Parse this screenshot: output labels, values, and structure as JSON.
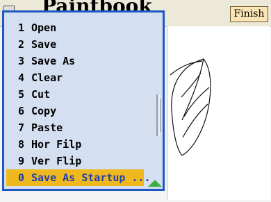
{
  "window": {
    "title": "Paintbook"
  },
  "toolbar": {
    "finish_label": "Finish"
  },
  "menu": {
    "items": [
      {
        "num": "1",
        "label": "Open"
      },
      {
        "num": "2",
        "label": "Save"
      },
      {
        "num": "3",
        "label": "Save As"
      },
      {
        "num": "4",
        "label": "Clear"
      },
      {
        "num": "5",
        "label": "Cut"
      },
      {
        "num": "6",
        "label": "Copy"
      },
      {
        "num": "7",
        "label": "Paste"
      },
      {
        "num": "8",
        "label": "Hor Filp"
      },
      {
        "num": "9",
        "label": "Ver Flip"
      },
      {
        "num": "0",
        "label": "Save As Startup ..."
      }
    ],
    "selected_index": 9
  },
  "icons": {
    "window": "app-menu-icon",
    "scroll_up": "triangle-up-icon",
    "scrollbar": "scrollbar-grip-icon"
  },
  "colors": {
    "menu_bg": "#d5dff2",
    "menu_border": "#1f57c4",
    "selected_bg": "#f0b81f",
    "selected_text": "#1f3fb0",
    "finish_bg": "#fbe5b6",
    "arrow": "#3cb043"
  }
}
